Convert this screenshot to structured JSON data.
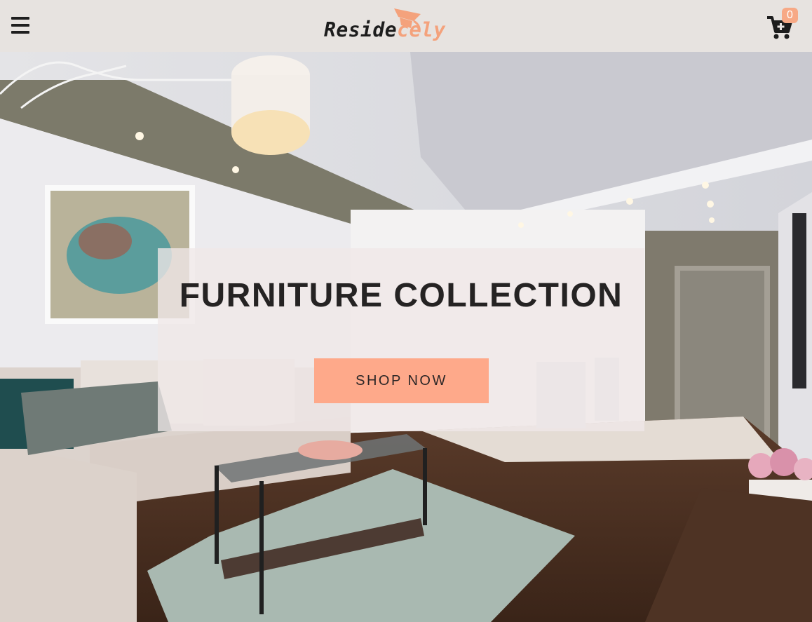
{
  "header": {
    "menu_icon": "hamburger-menu-icon",
    "logo": {
      "part1": "Reside",
      "part2": "cely",
      "icon": "graduation-cap-icon"
    },
    "cart": {
      "icon": "cart-plus-icon",
      "count": "0"
    }
  },
  "hero": {
    "title": "FURNITURE COLLECTION",
    "cta_label": "SHOP NOW"
  },
  "colors": {
    "accent": "#fea98a",
    "nav_background": "#e7e3e0",
    "text_dark": "#252323"
  }
}
